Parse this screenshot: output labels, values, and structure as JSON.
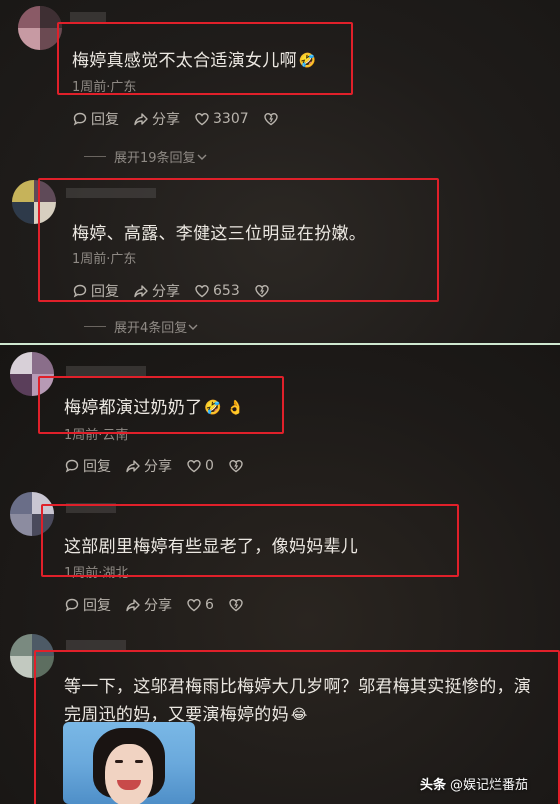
{
  "comments": [
    {
      "text": "梅婷真感觉不太合适演女儿啊",
      "emoji": "🤣",
      "meta": "1周前·广东",
      "reply": "回复",
      "share": "分享",
      "likes": "3307",
      "expand": "展开19条回复"
    },
    {
      "text": "梅婷、高露、李健这三位明显在扮嫩。",
      "meta": "1周前·广东",
      "reply": "回复",
      "share": "分享",
      "likes": "653",
      "expand": "展开4条回复"
    },
    {
      "text": "梅婷都演过奶奶了",
      "emoji": "🤣 👌",
      "meta": "1周前·云南",
      "reply": "回复",
      "share": "分享",
      "likes": "0"
    },
    {
      "text": "这部剧里梅婷有些显老了，像妈妈辈儿",
      "meta": "1周前·湖北",
      "reply": "回复",
      "share": "分享",
      "likes": "6"
    },
    {
      "text_line1": "等一下，这邬君梅雨比梅婷大几岁啊？邬君梅其实挺惨的，演",
      "text_line2": "完周迅的妈，又要演梅婷的妈",
      "emoji": "😂"
    }
  ],
  "watermark": {
    "prefix": "头条",
    "handle": "@娱记烂番茄"
  },
  "colors": {
    "highlight_box": "#e0202a",
    "divider": "#cfe8d0"
  },
  "icons": [
    "reply-icon",
    "share-icon",
    "like-icon",
    "dislike-icon",
    "chevron-down-icon"
  ]
}
